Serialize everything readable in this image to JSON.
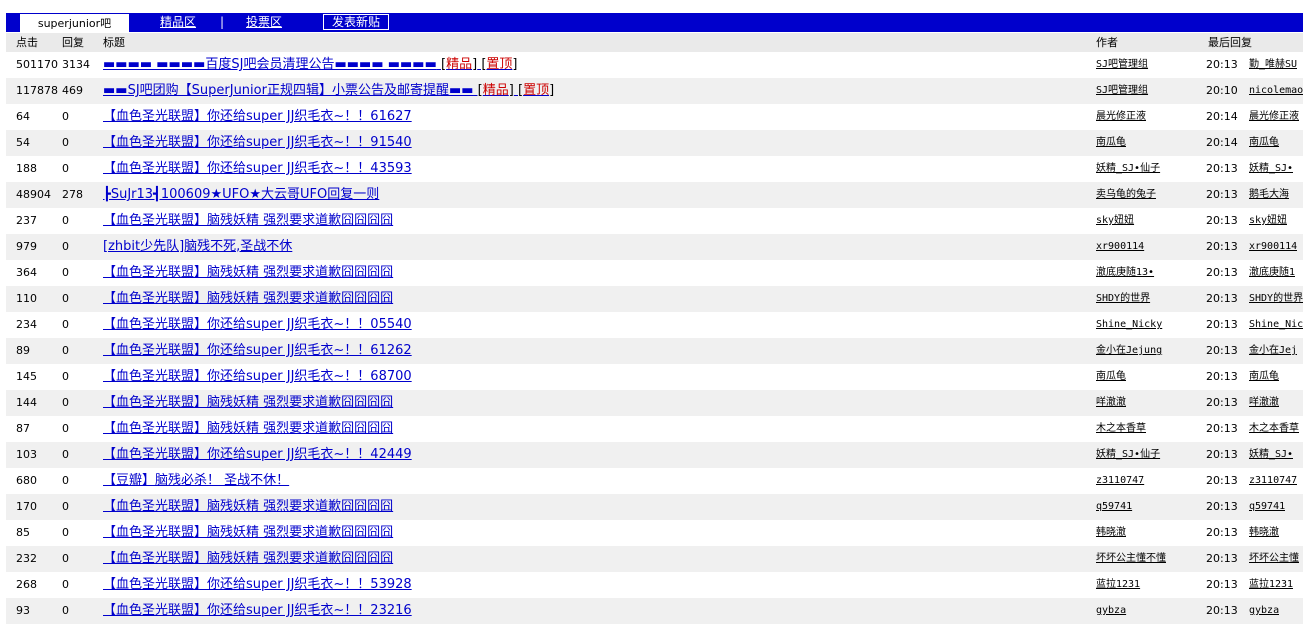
{
  "nav": {
    "active_tab": "superjunior吧",
    "tab_featured": "精品区",
    "separator": "|",
    "tab_vote": "投票区",
    "post_button": "发表新贴"
  },
  "columns": {
    "clicks": "点击",
    "replies": "回复",
    "title": "标题",
    "author": "作者",
    "last_reply": "最后回复"
  },
  "rows": [
    {
      "clicks": "501170",
      "replies": "3134",
      "title": "▬▬▬▬ ▬▬▬▬百度SJ吧会员清理公告▬▬▬▬ ▬▬▬▬",
      "tags": [
        "精品",
        "置顶"
      ],
      "author": "SJ吧管理组",
      "time": "20:13",
      "last": "勤_唯赫SU"
    },
    {
      "clicks": "117878",
      "replies": "469",
      "title": "▬▬SJ吧团购【SuperJunior正规四辑】小票公告及邮寄提醒▬▬",
      "tags": [
        "精品",
        "置顶"
      ],
      "author": "SJ吧管理组",
      "time": "20:10",
      "last": "nicolemao"
    },
    {
      "clicks": "64",
      "replies": "0",
      "title": "【血色圣光联盟】你还给super JJ织毛衣~！！61627",
      "tags": [],
      "author": "晨光修正液",
      "time": "20:14",
      "last": "晨光修正液"
    },
    {
      "clicks": "54",
      "replies": "0",
      "title": "【血色圣光联盟】你还给super JJ织毛衣~！！91540",
      "tags": [],
      "author": "南瓜龟",
      "time": "20:14",
      "last": "南瓜龟"
    },
    {
      "clicks": "188",
      "replies": "0",
      "title": "【血色圣光联盟】你还给super JJ织毛衣~！！43593",
      "tags": [],
      "author": "妖精_SJ•仙子",
      "time": "20:13",
      "last": "妖精_SJ•"
    },
    {
      "clicks": "48904",
      "replies": "278",
      "title": "┣SuJr13┫100609★UFO★大云哥UFO回复一则",
      "tags": [],
      "author": "卖乌龟的兔子",
      "time": "20:13",
      "last": "鹅毛大海"
    },
    {
      "clicks": "237",
      "replies": "0",
      "title": "【血色圣光联盟】脑残妖精 强烈要求道歉囧囧囧囧",
      "tags": [],
      "author": "sky妞妞",
      "time": "20:13",
      "last": "sky妞妞"
    },
    {
      "clicks": "979",
      "replies": "0",
      "title": "[zhbit少先队]脑残不死,圣战不休",
      "tags": [],
      "author": "xr900114",
      "time": "20:13",
      "last": "xr900114"
    },
    {
      "clicks": "364",
      "replies": "0",
      "title": "【血色圣光联盟】脑残妖精 强烈要求道歉囧囧囧囧",
      "tags": [],
      "author": "澈底庚随13•",
      "time": "20:13",
      "last": "澈底庚随1"
    },
    {
      "clicks": "110",
      "replies": "0",
      "title": "【血色圣光联盟】脑残妖精 强烈要求道歉囧囧囧囧",
      "tags": [],
      "author": "SHDY的世界",
      "time": "20:13",
      "last": "SHDY的世界"
    },
    {
      "clicks": "234",
      "replies": "0",
      "title": "【血色圣光联盟】你还给super JJ织毛衣~！！05540",
      "tags": [],
      "author": "Shine_Nicky",
      "time": "20:13",
      "last": "Shine_Nic"
    },
    {
      "clicks": "89",
      "replies": "0",
      "title": "【血色圣光联盟】你还给super JJ织毛衣~！！61262",
      "tags": [],
      "author": "金小在Jejung",
      "time": "20:13",
      "last": "金小在Jej"
    },
    {
      "clicks": "145",
      "replies": "0",
      "title": "【血色圣光联盟】你还给super JJ织毛衣~！！68700",
      "tags": [],
      "author": "南瓜龟",
      "time": "20:13",
      "last": "南瓜龟"
    },
    {
      "clicks": "144",
      "replies": "0",
      "title": "【血色圣光联盟】脑残妖精 强烈要求道歉囧囧囧囧",
      "tags": [],
      "author": "咩澈澈",
      "time": "20:13",
      "last": "咩澈澈"
    },
    {
      "clicks": "87",
      "replies": "0",
      "title": "【血色圣光联盟】脑残妖精 强烈要求道歉囧囧囧囧",
      "tags": [],
      "author": "木之本香草",
      "time": "20:13",
      "last": "木之本香草"
    },
    {
      "clicks": "103",
      "replies": "0",
      "title": "【血色圣光联盟】你还给super JJ织毛衣~！！42449",
      "tags": [],
      "author": "妖精_SJ•仙子",
      "time": "20:13",
      "last": "妖精_SJ•"
    },
    {
      "clicks": "680",
      "replies": "0",
      "title": "【豆瓣】脑残必杀！ 圣战不休！",
      "tags": [],
      "author": "z3110747",
      "time": "20:13",
      "last": "z3110747"
    },
    {
      "clicks": "170",
      "replies": "0",
      "title": "【血色圣光联盟】脑残妖精 强烈要求道歉囧囧囧囧",
      "tags": [],
      "author": "q59741",
      "time": "20:13",
      "last": "q59741"
    },
    {
      "clicks": "85",
      "replies": "0",
      "title": "【血色圣光联盟】脑残妖精 强烈要求道歉囧囧囧囧",
      "tags": [],
      "author": "韩晓澈",
      "time": "20:13",
      "last": "韩晓澈"
    },
    {
      "clicks": "232",
      "replies": "0",
      "title": "【血色圣光联盟】脑残妖精 强烈要求道歉囧囧囧囧",
      "tags": [],
      "author": "坏坏公主懂不懂",
      "time": "20:13",
      "last": "坏坏公主懂"
    },
    {
      "clicks": "268",
      "replies": "0",
      "title": "【血色圣光联盟】你还给super JJ织毛衣~！！53928",
      "tags": [],
      "author": "蓝拉1231",
      "time": "20:13",
      "last": "蓝拉1231"
    },
    {
      "clicks": "93",
      "replies": "0",
      "title": "【血色圣光联盟】你还给super JJ织毛衣~！！23216",
      "tags": [],
      "author": "gybza",
      "time": "20:13",
      "last": "gybza"
    }
  ]
}
